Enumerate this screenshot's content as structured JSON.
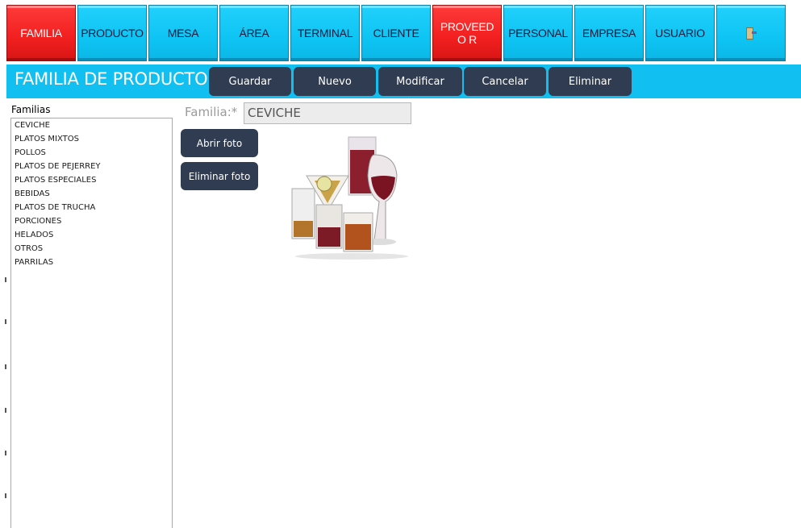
{
  "nav": {
    "items": [
      {
        "label": "FAMILIA",
        "active": true
      },
      {
        "label": "PRODUCTO",
        "active": false
      },
      {
        "label": "MESA",
        "active": false
      },
      {
        "label": "ÁREA",
        "active": false
      },
      {
        "label": "TERMINAL",
        "active": false
      },
      {
        "label": "CLIENTE",
        "active": false
      },
      {
        "label": "PROVEEDO R",
        "active": true
      },
      {
        "label": "PERSONAL",
        "active": false
      },
      {
        "label": "EMPRESA",
        "active": false
      },
      {
        "label": "USUARIO",
        "active": false
      }
    ],
    "exit_icon": "exit-door-icon"
  },
  "header": {
    "title": "FAMILIA DE PRODUCTO",
    "actions": {
      "guardar": "Guardar",
      "nuevo": "Nuevo",
      "modificar": "Modificar",
      "cancelar": "Cancelar",
      "eliminar": "Eliminar"
    }
  },
  "sidebar": {
    "label": "Familias",
    "items": [
      "CEVICHE",
      "PLATOS MIXTOS",
      "POLLOS",
      "PLATOS DE PEJERREY",
      "PLATOS ESPECIALES",
      "BEBIDAS",
      "PLATOS DE TRUCHA",
      "PORCIONES",
      "HELADOS",
      "OTROS",
      "PARRILAS"
    ]
  },
  "form": {
    "familia_label": "Familia:*",
    "familia_value": "CEVICHE",
    "open_photo": "Abrir foto",
    "delete_photo": "Eliminar foto"
  },
  "colors": {
    "accent": "#11bff1",
    "active": "#f21f1f",
    "button_dark": "#2f3c51"
  }
}
